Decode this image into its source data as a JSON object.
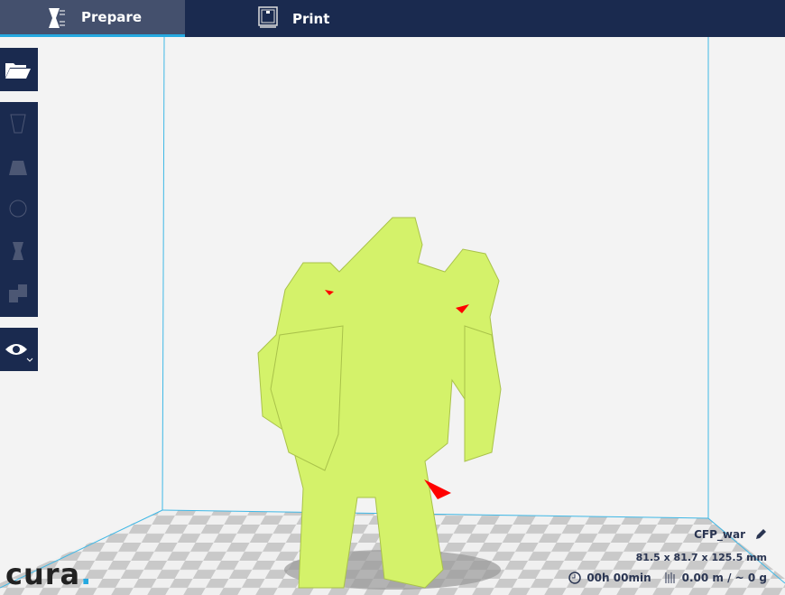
{
  "tabs": [
    {
      "label": "Prepare",
      "icon": "prepare-icon"
    },
    {
      "label": "Print",
      "icon": "printer-icon"
    }
  ],
  "toolbar": {
    "tools": [
      "open-folder-icon",
      "move-icon",
      "scale-icon",
      "rotate-icon",
      "mirror-icon",
      "per-model-settings-icon",
      "view-mode-icon"
    ]
  },
  "object": {
    "name": "CFP_war",
    "dimensions": "81.5 x 81.7 x 125.5 mm",
    "print_time": "00h 00min",
    "material": "0.00 m / ~ 0 g"
  },
  "logo": {
    "text": "cura"
  },
  "colors": {
    "topbar": "#1a2a4f",
    "accent": "#26a9e0",
    "model": "#d4f26a"
  }
}
